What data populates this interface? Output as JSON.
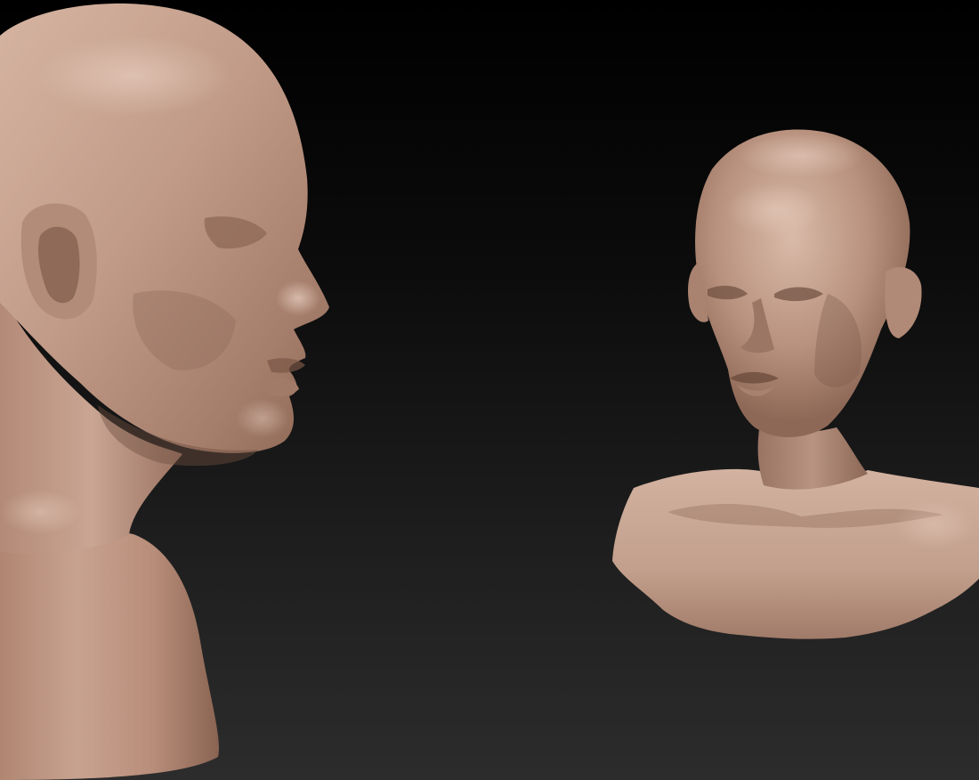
{
  "viewport": {
    "background_top": "#000000",
    "background_bottom": "#2c2c2c"
  },
  "material": {
    "name": "clay",
    "base_color": "#c09a87",
    "light_color": "#e4c8b8",
    "shadow_color": "#7a5a4a",
    "deep_shadow_color": "#4a3228"
  },
  "objects": [
    {
      "name": "sculpt-head-profile",
      "view": "side-profile"
    },
    {
      "name": "sculpt-bust-front",
      "view": "front-three-quarter"
    }
  ]
}
